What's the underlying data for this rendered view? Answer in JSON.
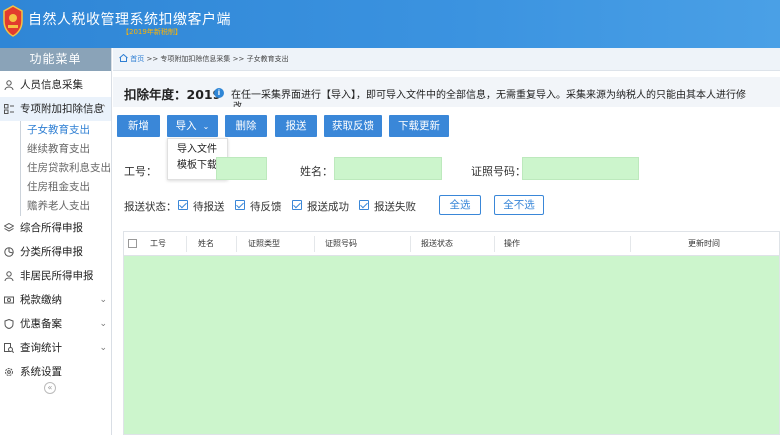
{
  "app": {
    "title": "自然人税收管理系统扣缴客户端",
    "version": "【2019年新税制】"
  },
  "sidebar": {
    "header": "功能菜单",
    "items": [
      {
        "label": "人员信息采集",
        "icon": "person-icon"
      },
      {
        "label": "专项附加扣除信息",
        "icon": "list-icon",
        "expanded": true,
        "children": [
          {
            "label": "子女教育支出",
            "active": true
          },
          {
            "label": "继续教育支出"
          },
          {
            "label": "住房贷款利息支出"
          },
          {
            "label": "住房租金支出"
          },
          {
            "label": "赡养老人支出"
          }
        ]
      },
      {
        "label": "综合所得申报",
        "icon": "layers-icon"
      },
      {
        "label": "分类所得申报",
        "icon": "pie-icon"
      },
      {
        "label": "非居民所得申报",
        "icon": "user-icon"
      },
      {
        "label": "税款缴纳",
        "icon": "money-icon",
        "chevron": "⌄"
      },
      {
        "label": "优惠备案",
        "icon": "shield-icon",
        "chevron": "⌄"
      },
      {
        "label": "查询统计",
        "icon": "search-icon",
        "chevron": "⌄"
      },
      {
        "label": "系统设置",
        "icon": "gear-icon"
      }
    ],
    "collapse_glyph": "«"
  },
  "breadcrumb": {
    "home": "首页",
    "sep1": " >> ",
    "level1": "专项附加扣除信息采集",
    "sep2": " >> ",
    "level2": "子女教育支出"
  },
  "main": {
    "year_label": "扣除年度：2019",
    "info_icon": "i",
    "info_text": "在任一采集界面进行【导入】，即可导入文件中的全部信息，无需重复导入。采集来源为纳税人的只能由其本人进行修",
    "info_text_2": "改",
    "toolbar": {
      "add": "新增",
      "import": "导入",
      "import_caret": "⌄",
      "delete": "删除",
      "send": "报送",
      "feedback": "获取反馈",
      "download": "下载更新"
    },
    "import_menu": [
      "导入文件",
      "模板下载"
    ],
    "filters": {
      "id_label": "工号：",
      "name_label": "姓名：",
      "cert_label": "证照号码："
    },
    "status": {
      "label": "报送状态：",
      "options": [
        "待报送",
        "待反馈",
        "报送成功",
        "报送失败"
      ],
      "select_all": "全选",
      "select_none": "全不选"
    },
    "table": {
      "columns": [
        "工号",
        "姓名",
        "证照类型",
        "证照号码",
        "报送状态",
        "操作",
        "更新时间"
      ],
      "rows": []
    }
  },
  "colors": {
    "header": "#2f86d6",
    "accent": "#3a87d8",
    "input_fill": "#ccf5cc",
    "version": "#ffb400"
  }
}
